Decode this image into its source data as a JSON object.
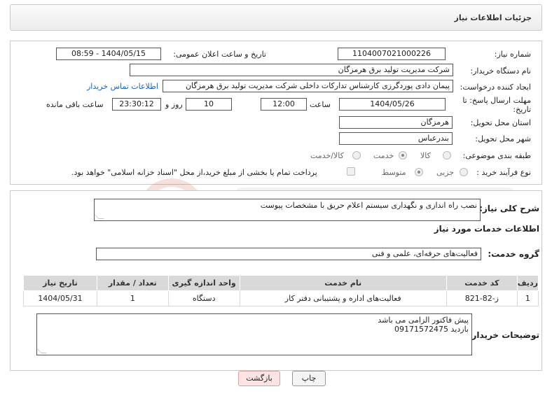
{
  "header": {
    "title": "جزئیات اطلاعات نیاز"
  },
  "fields": {
    "need_number_label": "شماره نیاز:",
    "need_number": "1104007021000226",
    "announce_label": "تاریخ و ساعت اعلان عمومی:",
    "announce_value": "1404/05/15 - 08:59",
    "buyer_org_label": "نام دستگاه خریدار:",
    "buyer_org": "شرکت مدیریت تولید برق هرمزگان",
    "requester_label": "ایجاد کننده درخواست:",
    "requester": "پیمان دادی پوردگرزی کارشناس تدارکات داخلی شرکت مدیریت تولید برق هرمزگان",
    "buyer_contact_link": "اطلاعات تماس خریدار",
    "deadline_label_1": "مهلت ارسال پاسخ: تا",
    "deadline_label_2": "تاریخ:",
    "deadline_date": "1404/05/26",
    "time_label": "ساعت",
    "deadline_time": "12:00",
    "days_count": "10",
    "days_label": "روز و",
    "remaining_time": "23:30:12",
    "remaining_label": "ساعت باقی مانده",
    "province_label": "استان محل تحویل:",
    "province": "هرمزگان",
    "city_label": "شهر محل تحویل:",
    "city": "بندرعباس",
    "category_label": "طبقه بندی موضوعی:",
    "category_options": [
      "کالا",
      "خدمت",
      "کالا/خدمت"
    ],
    "process_label": "نوع فرآیند خرید :",
    "process_options": [
      "جزیی",
      "متوسط"
    ],
    "payment_note": "پرداخت تمام یا بخشی از مبلغ خرید،از محل \"اسناد خزانه اسلامی\" خواهد بود."
  },
  "summary": {
    "label": "شرح کلی نیاز:",
    "text": "نصب راه اندازی و نگهداری سیستم اعلام حریق با مشخصات پیوست"
  },
  "services": {
    "section_title": "اطلاعات خدمات مورد نیاز",
    "group_label": "گروه خدمت:",
    "group_value": "فعالیت‌های حرفه‌ای، علمی و فنی"
  },
  "table": {
    "headers": [
      "ردیف",
      "کد خدمت",
      "نام خدمت",
      "واحد اندازه گیری",
      "تعداد / مقدار",
      "تاریخ نیاز"
    ],
    "rows": [
      [
        "1",
        "ز-82-821",
        "فعالیت‌های اداره و پشتیبانی دفتر کار",
        "دستگاه",
        "1",
        "1404/05/31"
      ]
    ]
  },
  "buyer_notes": {
    "label": "توضیحات خریدار:",
    "line1": "پیش فاکتور الزامی می باشد",
    "line2": "بازدید 09171572475"
  },
  "buttons": {
    "print": "چاپ",
    "back": "بازگشت"
  },
  "colors": {
    "link": "#1565c0",
    "back_button_bg": "#fde4e4",
    "header_bg": "#ececec"
  }
}
